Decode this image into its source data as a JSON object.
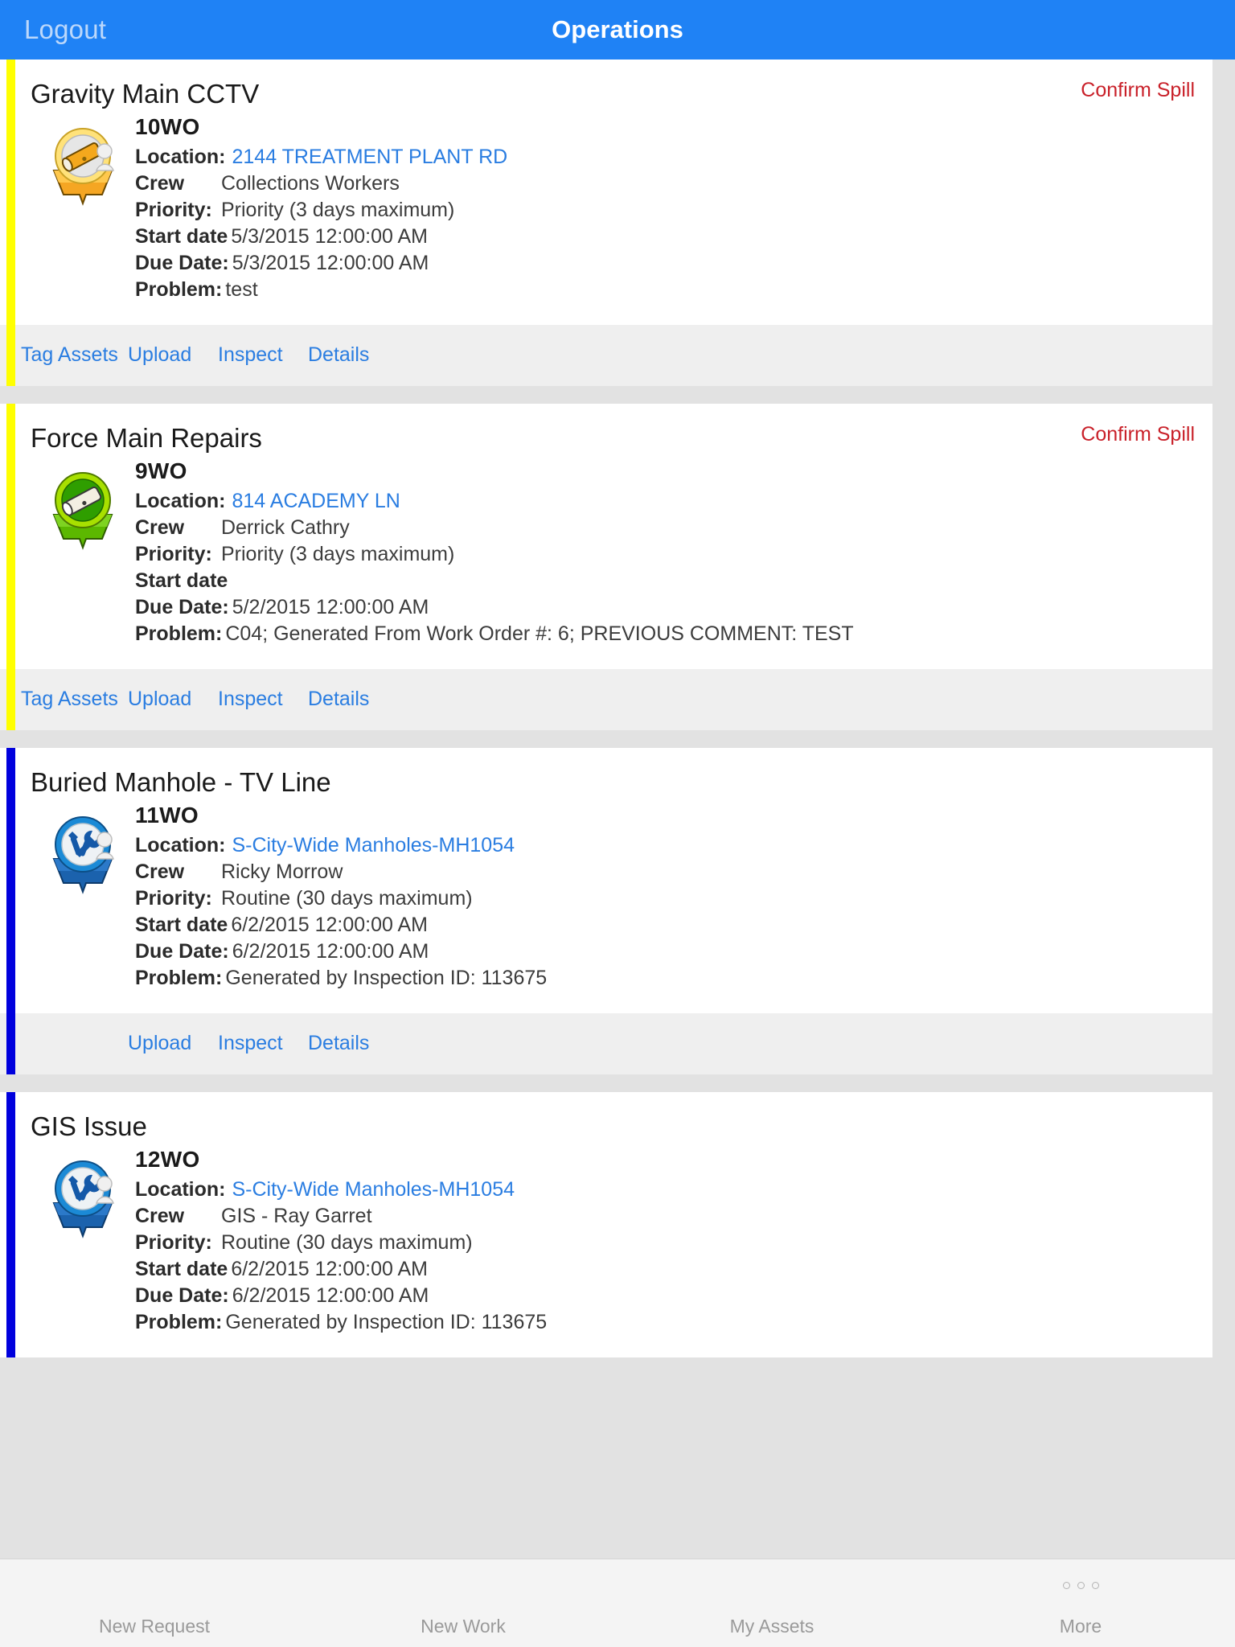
{
  "header": {
    "logout_label": "Logout",
    "title": "Operations"
  },
  "colors": {
    "navbar": "#1f82f5",
    "link": "#2a7de1",
    "danger": "#c9212a",
    "accent_yellow": "#ffff00",
    "accent_blue": "#0000dd",
    "page_bg": "#e2e2e2",
    "action_bar_bg": "#efefef"
  },
  "field_labels": {
    "location": "Location:",
    "crew": "Crew",
    "priority": "Priority:",
    "start_date": "Start date",
    "due_date": "Due Date:",
    "problem": "Problem:"
  },
  "cards": [
    {
      "title": "Gravity Main CCTV",
      "wo": "10WO",
      "accent": "#ffff00",
      "icon": "pipe-pin-yellow-icon",
      "confirm_spill": "Confirm Spill",
      "location": "2144  TREATMENT PLANT RD",
      "crew": "Collections Workers",
      "priority": "Priority (3 days maximum)",
      "start_date": "5/3/2015 12:00:00 AM",
      "due_date": "5/3/2015 12:00:00 AM",
      "problem": "test",
      "actions": [
        "Tag Assets",
        "Upload",
        "Inspect",
        "Details"
      ]
    },
    {
      "title": "Force Main Repairs",
      "wo": "9WO",
      "accent": "#ffff00",
      "icon": "pipe-pin-green-icon",
      "confirm_spill": "Confirm Spill",
      "location": "814  ACADEMY LN",
      "crew": "Derrick Cathry",
      "priority": "Priority (3 days maximum)",
      "start_date": "",
      "due_date": "5/2/2015 12:00:00 AM",
      "problem": "C04; Generated From Work Order #: 6; PREVIOUS COMMENT: TEST",
      "actions": [
        "Tag Assets",
        "Upload",
        "Inspect",
        "Details"
      ]
    },
    {
      "title": "Buried Manhole - TV Line",
      "wo": "11WO",
      "accent": "#0000dd",
      "icon": "tools-pin-blue-icon",
      "confirm_spill": "",
      "location": "S-City-Wide Manholes-MH1054",
      "crew": "Ricky Morrow",
      "priority": "Routine (30 days maximum)",
      "start_date": "6/2/2015 12:00:00 AM",
      "due_date": "6/2/2015 12:00:00 AM",
      "problem": "Generated by Inspection ID: 113675",
      "actions": [
        "",
        "Upload",
        "Inspect",
        "Details"
      ]
    },
    {
      "title": "GIS Issue",
      "wo": "12WO",
      "accent": "#0000dd",
      "icon": "tools-pin-blue-icon",
      "confirm_spill": "",
      "location": "S-City-Wide Manholes-MH1054",
      "crew": "GIS - Ray Garret",
      "priority": "Routine (30 days maximum)",
      "start_date": "6/2/2015 12:00:00 AM",
      "due_date": "6/2/2015 12:00:00 AM",
      "problem": "Generated by Inspection ID: 113675",
      "actions": []
    }
  ],
  "tabbar": {
    "items": [
      {
        "label": "New Request",
        "icon": "document-plus-icon",
        "dots": false
      },
      {
        "label": "New Work",
        "icon": "wrench-plus-icon",
        "dots": false
      },
      {
        "label": "My Assets",
        "icon": "assets-icon",
        "dots": false
      },
      {
        "label": "More",
        "icon": "ellipsis-icon",
        "dots": true
      }
    ]
  }
}
